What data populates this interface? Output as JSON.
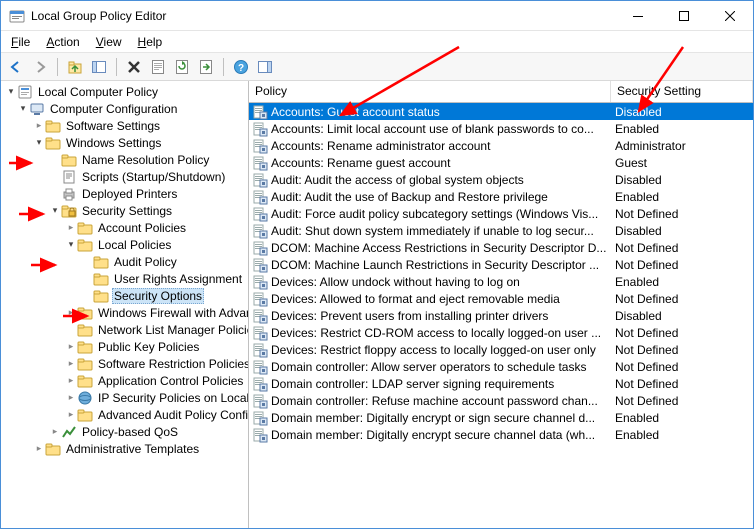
{
  "titlebar": {
    "title": "Local Group Policy Editor"
  },
  "menubar": {
    "items": [
      {
        "pre": "",
        "hot": "F",
        "post": "ile"
      },
      {
        "pre": "",
        "hot": "A",
        "post": "ction"
      },
      {
        "pre": "",
        "hot": "V",
        "post": "iew"
      },
      {
        "pre": "",
        "hot": "H",
        "post": "elp"
      }
    ]
  },
  "toolbar_icons": [
    "back",
    "forward",
    "up",
    "show-hide-tree",
    "delete",
    "properties",
    "refresh",
    "export-list",
    "help",
    "show-hide-action"
  ],
  "tree": [
    {
      "indent": 0,
      "twist": "expanded",
      "icon": "policy-root",
      "label": "Local Computer Policy",
      "sel": false
    },
    {
      "indent": 1,
      "twist": "expanded",
      "icon": "computer",
      "label": "Computer Configuration",
      "sel": false
    },
    {
      "indent": 2,
      "twist": "collapsed",
      "icon": "folder",
      "label": "Software Settings",
      "sel": false
    },
    {
      "indent": 2,
      "twist": "expanded",
      "icon": "folder",
      "label": "Windows Settings",
      "sel": false
    },
    {
      "indent": 3,
      "twist": "none",
      "icon": "folder",
      "label": "Name Resolution Policy",
      "sel": false
    },
    {
      "indent": 3,
      "twist": "none",
      "icon": "script",
      "label": "Scripts (Startup/Shutdown)",
      "sel": false
    },
    {
      "indent": 3,
      "twist": "none",
      "icon": "printer",
      "label": "Deployed Printers",
      "sel": false
    },
    {
      "indent": 3,
      "twist": "expanded",
      "icon": "security",
      "label": "Security Settings",
      "sel": false
    },
    {
      "indent": 4,
      "twist": "collapsed",
      "icon": "folder",
      "label": "Account Policies",
      "sel": false
    },
    {
      "indent": 4,
      "twist": "expanded",
      "icon": "folder",
      "label": "Local Policies",
      "sel": false
    },
    {
      "indent": 5,
      "twist": "none",
      "icon": "folder",
      "label": "Audit Policy",
      "sel": false
    },
    {
      "indent": 5,
      "twist": "none",
      "icon": "folder",
      "label": "User Rights Assignment",
      "sel": false
    },
    {
      "indent": 5,
      "twist": "none",
      "icon": "folder",
      "label": "Security Options",
      "sel": true
    },
    {
      "indent": 4,
      "twist": "collapsed",
      "icon": "folder",
      "label": "Windows Firewall with Advanced Security",
      "sel": false
    },
    {
      "indent": 4,
      "twist": "none",
      "icon": "folder",
      "label": "Network List Manager Policies",
      "sel": false
    },
    {
      "indent": 4,
      "twist": "collapsed",
      "icon": "folder",
      "label": "Public Key Policies",
      "sel": false
    },
    {
      "indent": 4,
      "twist": "collapsed",
      "icon": "folder",
      "label": "Software Restriction Policies",
      "sel": false
    },
    {
      "indent": 4,
      "twist": "collapsed",
      "icon": "folder",
      "label": "Application Control Policies",
      "sel": false
    },
    {
      "indent": 4,
      "twist": "collapsed",
      "icon": "ipsec",
      "label": "IP Security Policies on Local Computer",
      "sel": false
    },
    {
      "indent": 4,
      "twist": "collapsed",
      "icon": "folder",
      "label": "Advanced Audit Policy Configuration",
      "sel": false
    },
    {
      "indent": 3,
      "twist": "collapsed",
      "icon": "qos",
      "label": "Policy-based QoS",
      "sel": false
    },
    {
      "indent": 2,
      "twist": "collapsed",
      "icon": "folder",
      "label": "Administrative Templates",
      "sel": false
    }
  ],
  "columns": {
    "c1": "Policy",
    "c2": "Security Setting"
  },
  "rows": [
    {
      "policy": "Accounts: Guest account status",
      "setting": "Disabled",
      "sel": true
    },
    {
      "policy": "Accounts: Limit local account use of blank passwords to co...",
      "setting": "Enabled",
      "sel": false
    },
    {
      "policy": "Accounts: Rename administrator account",
      "setting": "Administrator",
      "sel": false
    },
    {
      "policy": "Accounts: Rename guest account",
      "setting": "Guest",
      "sel": false
    },
    {
      "policy": "Audit: Audit the access of global system objects",
      "setting": "Disabled",
      "sel": false
    },
    {
      "policy": "Audit: Audit the use of Backup and Restore privilege",
      "setting": "Enabled",
      "sel": false
    },
    {
      "policy": "Audit: Force audit policy subcategory settings (Windows Vis...",
      "setting": "Not Defined",
      "sel": false
    },
    {
      "policy": "Audit: Shut down system immediately if unable to log secur...",
      "setting": "Disabled",
      "sel": false
    },
    {
      "policy": "DCOM: Machine Access Restrictions in Security Descriptor D...",
      "setting": "Not Defined",
      "sel": false
    },
    {
      "policy": "DCOM: Machine Launch Restrictions in Security Descriptor ...",
      "setting": "Not Defined",
      "sel": false
    },
    {
      "policy": "Devices: Allow undock without having to log on",
      "setting": "Enabled",
      "sel": false
    },
    {
      "policy": "Devices: Allowed to format and eject removable media",
      "setting": "Not Defined",
      "sel": false
    },
    {
      "policy": "Devices: Prevent users from installing printer drivers",
      "setting": "Disabled",
      "sel": false
    },
    {
      "policy": "Devices: Restrict CD-ROM access to locally logged-on user ...",
      "setting": "Not Defined",
      "sel": false
    },
    {
      "policy": "Devices: Restrict floppy access to locally logged-on user only",
      "setting": "Not Defined",
      "sel": false
    },
    {
      "policy": "Domain controller: Allow server operators to schedule tasks",
      "setting": "Not Defined",
      "sel": false
    },
    {
      "policy": "Domain controller: LDAP server signing requirements",
      "setting": "Not Defined",
      "sel": false
    },
    {
      "policy": "Domain controller: Refuse machine account password chan...",
      "setting": "Not Defined",
      "sel": false
    },
    {
      "policy": "Domain member: Digitally encrypt or sign secure channel d...",
      "setting": "Enabled",
      "sel": false
    },
    {
      "policy": "Domain member: Digitally encrypt secure channel data (wh...",
      "setting": "Enabled",
      "sel": false
    }
  ]
}
